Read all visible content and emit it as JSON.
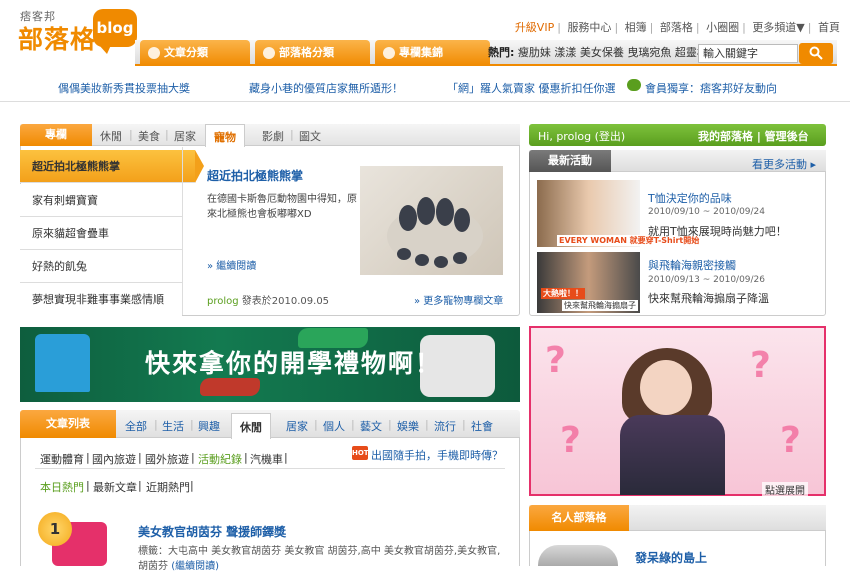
{
  "header": {
    "logo_small": "痞客邦",
    "logo_main": "部落格",
    "logo_bubble": "blog",
    "toplinks": [
      "升級VIP",
      "服務中心",
      "相簿",
      "部落格",
      "小圈圈",
      "更多頻道▼",
      "首頁"
    ],
    "nav_tabs": [
      "文章分類",
      "部落格分類",
      "專欄集錦"
    ],
    "hot_label": "熱門:",
    "hot_keywords": "瘦肋妹 漾漾 美女保養 曳璃宛魚 超靈板",
    "search_placeholder": "輸入關鍵字"
  },
  "promo": [
    "偶偶美妝新秀貫投票抽大獎",
    "藏身小巷的優質店家無所遁形！",
    "「網」羅人氣賣家 優惠折扣任你選",
    "會員獨享：痞客邦好友動向"
  ],
  "featured": {
    "head": "專欄",
    "tabs": [
      "休閒",
      "美食",
      "居家",
      "寵物",
      "影劇",
      "圖文"
    ],
    "active_tab": "寵物",
    "list": [
      "超近拍北極熊熊掌",
      "家有刺蝟寶寶",
      "原來貓超會疊車",
      "好熱的飢兔",
      "夢想實現非難事事業感情順"
    ],
    "title": "超近拍北極熊熊掌",
    "desc": "在德國卡斯魯厄動物園中得知，原來北極熊也會板嘟嘟XD",
    "read_more": "» 繼續閱讀",
    "author": "prolog",
    "posted": " 發表於2010.09.05",
    "more_link": "» 更多寵物專欄文章"
  },
  "banner": {
    "text": "快來拿你的開學禮物啊！"
  },
  "articles": {
    "head": "文章列表",
    "tabs": [
      "全部",
      "生活",
      "興趣",
      "休閒",
      "居家",
      "個人",
      "藝文",
      "娛樂",
      "流行",
      "社會"
    ],
    "active_tab": "休閒",
    "sub1": [
      "運動體育",
      "國內旅遊",
      "國外旅遊",
      "活動紀錄",
      "汽機車"
    ],
    "sub1_active": "活動紀錄",
    "hot_badge": "HOT",
    "hot_link": "出國隨手拍，手機即時傳？",
    "sub2": [
      "本日熱門",
      "最新文章",
      "近期熱門"
    ],
    "sub2_active": "本日熱門",
    "item": {
      "rank": "1",
      "title": "美女教官胡茵芬 聲援師鐸獎",
      "tags": "標籤：大屯高中 美女教官胡茵芬 美女教官 胡茵芬,高中 美女教官胡茵芬,美女教官,胡茵芬",
      "tags_more": "(繼續閱讀)"
    }
  },
  "user": {
    "greeting": "Hi, prolog (登出)",
    "links": "我的部落格 | 管理後台"
  },
  "activities": {
    "head": "最新活動",
    "more": "看更多活動 ▸",
    "items": [
      {
        "title": "T恤決定你的品味",
        "date": "2010/09/10 ~ 2010/09/24",
        "desc": "就用T恤來展現時尚魅力吧！",
        "cap": "EVERY WOMAN 就要穿T-Shirt開始"
      },
      {
        "title": "與飛輪海親密接觸",
        "date": "2010/09/13 ~ 2010/09/26",
        "desc": "快來幫飛輪海搧扇子降溫",
        "cap": "大熱啦！！",
        "cap2": "快來幫飛輪海搧扇子"
      }
    ]
  },
  "pink_ad": {
    "caption": "點選展開"
  },
  "celebrity": {
    "head": "名人部落格",
    "name": "發呆綠的島上"
  },
  "colors": {
    "accent": "#f08a00",
    "link": "#1e5fa8",
    "green": "#5a9e1e",
    "pink": "#e5306a"
  }
}
